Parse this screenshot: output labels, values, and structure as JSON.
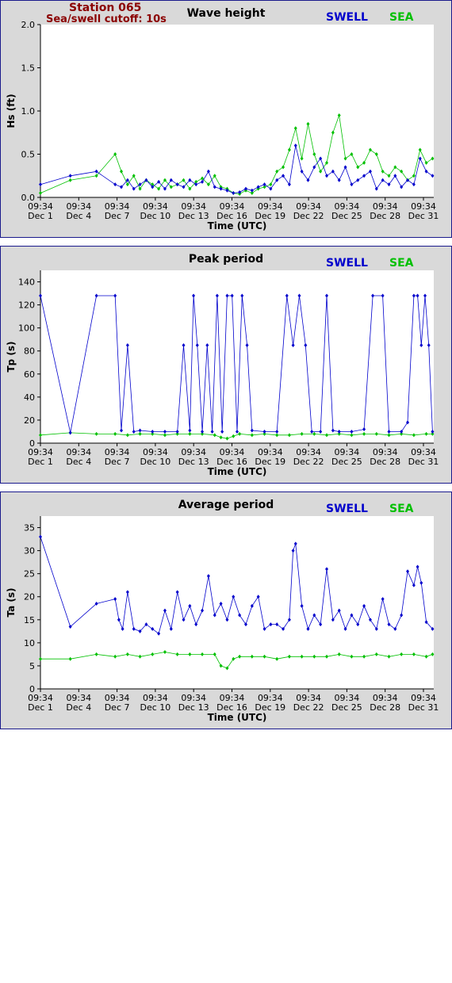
{
  "header": {
    "station": "Station 065",
    "cutoff": "Sea/swell cutoff: 10s"
  },
  "legend": {
    "swell": "SWELL",
    "sea": "SEA"
  },
  "colors": {
    "swell": "#0000cc",
    "sea": "#00c000",
    "frame": "#1a1a8c",
    "header": "#8b0000"
  },
  "x_axis": {
    "label": "Time (UTC)",
    "ticks": [
      {
        "time": "09:34",
        "date": "Dec 1"
      },
      {
        "time": "09:34",
        "date": "Dec 4"
      },
      {
        "time": "09:34",
        "date": "Dec 7"
      },
      {
        "time": "09:34",
        "date": "Dec 10"
      },
      {
        "time": "09:34",
        "date": "Dec 13"
      },
      {
        "time": "09:34",
        "date": "Dec 16"
      },
      {
        "time": "09:34",
        "date": "Dec 19"
      },
      {
        "time": "09:34",
        "date": "Dec 22"
      },
      {
        "time": "09:34",
        "date": "Dec 25"
      },
      {
        "time": "09:34",
        "date": "Dec 28"
      },
      {
        "time": "09:34",
        "date": "Dec 31"
      }
    ]
  },
  "chart_data": [
    {
      "type": "scatter",
      "title": "Wave height",
      "ylabel": "Hs (ft)",
      "xlabel": "Time (UTC)",
      "x_unit": "day of December",
      "xlim": [
        1,
        32.6
      ],
      "ylim": [
        0,
        2.0
      ],
      "yticks": [
        "0.0",
        "0.5",
        "1.0",
        "1.5",
        "2.0"
      ],
      "ytick_values": [
        0,
        0.5,
        1.0,
        1.5,
        2.0
      ],
      "series": [
        {
          "name": "SWELL",
          "x": [
            1.0,
            3.4,
            5.5,
            7.0,
            7.5,
            8.0,
            8.5,
            9.0,
            9.5,
            10.0,
            10.5,
            11.0,
            11.5,
            12.0,
            12.5,
            13.0,
            13.5,
            14.0,
            14.5,
            15.0,
            15.5,
            16.0,
            16.5,
            17.0,
            17.5,
            18.0,
            18.5,
            19.0,
            19.5,
            20.0,
            20.5,
            21.0,
            21.5,
            22.0,
            22.5,
            23.0,
            23.5,
            24.0,
            24.5,
            25.0,
            25.5,
            26.0,
            26.5,
            27.0,
            27.5,
            28.0,
            28.5,
            29.0,
            29.5,
            30.0,
            30.5,
            31.0,
            31.5,
            32.0,
            32.5
          ],
          "y": [
            0.15,
            0.25,
            0.3,
            0.15,
            0.12,
            0.2,
            0.1,
            0.15,
            0.2,
            0.12,
            0.18,
            0.1,
            0.2,
            0.15,
            0.12,
            0.2,
            0.15,
            0.18,
            0.3,
            0.12,
            0.1,
            0.08,
            0.05,
            0.06,
            0.1,
            0.08,
            0.12,
            0.15,
            0.1,
            0.2,
            0.25,
            0.15,
            0.6,
            0.3,
            0.2,
            0.35,
            0.45,
            0.25,
            0.3,
            0.2,
            0.35,
            0.15,
            0.2,
            0.25,
            0.3,
            0.1,
            0.2,
            0.15,
            0.25,
            0.12,
            0.2,
            0.15,
            0.45,
            0.3,
            0.25
          ]
        },
        {
          "name": "SEA",
          "x": [
            1.0,
            3.4,
            5.5,
            7.0,
            7.5,
            8.0,
            8.5,
            9.0,
            9.5,
            10.0,
            10.5,
            11.0,
            11.5,
            12.0,
            12.5,
            13.0,
            13.5,
            14.0,
            14.5,
            15.0,
            15.5,
            16.0,
            16.5,
            17.0,
            17.5,
            18.0,
            18.5,
            19.0,
            19.5,
            20.0,
            20.5,
            21.0,
            21.5,
            22.0,
            22.5,
            23.0,
            23.5,
            24.0,
            24.5,
            25.0,
            25.5,
            26.0,
            26.5,
            27.0,
            27.5,
            28.0,
            28.5,
            29.0,
            29.5,
            30.0,
            30.5,
            31.0,
            31.5,
            32.0,
            32.5
          ],
          "y": [
            0.05,
            0.2,
            0.25,
            0.5,
            0.3,
            0.15,
            0.25,
            0.1,
            0.2,
            0.15,
            0.1,
            0.2,
            0.12,
            0.15,
            0.2,
            0.1,
            0.18,
            0.22,
            0.15,
            0.25,
            0.12,
            0.1,
            0.05,
            0.04,
            0.08,
            0.05,
            0.1,
            0.12,
            0.15,
            0.3,
            0.35,
            0.55,
            0.8,
            0.45,
            0.85,
            0.5,
            0.3,
            0.4,
            0.75,
            0.95,
            0.45,
            0.5,
            0.35,
            0.4,
            0.55,
            0.5,
            0.3,
            0.25,
            0.35,
            0.3,
            0.2,
            0.25,
            0.55,
            0.4,
            0.45
          ]
        }
      ]
    },
    {
      "type": "scatter",
      "title": "Peak period",
      "ylabel": "Tp (s)",
      "xlabel": "Time (UTC)",
      "x_unit": "day of December",
      "xlim": [
        1,
        32.6
      ],
      "ylim": [
        0,
        150
      ],
      "yticks": [
        "0",
        "20",
        "40",
        "60",
        "80",
        "100",
        "120",
        "140"
      ],
      "ytick_values": [
        0,
        20,
        40,
        60,
        80,
        100,
        120,
        140
      ],
      "series": [
        {
          "name": "SWELL",
          "x": [
            1.0,
            3.4,
            5.5,
            7.0,
            7.5,
            8.0,
            8.5,
            9.0,
            10.0,
            11.0,
            12.0,
            12.5,
            13.0,
            13.3,
            13.6,
            14.0,
            14.4,
            14.8,
            15.2,
            15.6,
            16.0,
            16.4,
            16.8,
            17.2,
            17.6,
            18.0,
            19.0,
            20.0,
            20.8,
            21.3,
            21.8,
            22.3,
            22.8,
            23.5,
            24.0,
            24.5,
            25.0,
            26.0,
            27.0,
            27.7,
            28.5,
            29.0,
            30.0,
            30.5,
            31.0,
            31.3,
            31.6,
            31.9,
            32.2,
            32.5
          ],
          "y": [
            128,
            9,
            128,
            128,
            11,
            85,
            10,
            11,
            10,
            10,
            10,
            85,
            11,
            128,
            85,
            10,
            85,
            10,
            128,
            10,
            128,
            128,
            10,
            128,
            85,
            11,
            10,
            10,
            128,
            85,
            128,
            85,
            10,
            10,
            128,
            11,
            10,
            10,
            12,
            128,
            128,
            10,
            10,
            18,
            128,
            128,
            85,
            128,
            85,
            10
          ]
        },
        {
          "name": "SEA",
          "x": [
            1.0,
            3.4,
            5.5,
            7.0,
            8.0,
            9.0,
            10.0,
            11.0,
            12.0,
            13.0,
            14.0,
            15.0,
            15.5,
            16.0,
            16.5,
            17.0,
            18.0,
            19.0,
            20.0,
            21.0,
            22.0,
            23.0,
            24.0,
            25.0,
            26.0,
            27.0,
            28.0,
            29.0,
            30.0,
            31.0,
            32.0,
            32.5
          ],
          "y": [
            7,
            9,
            8,
            8,
            7,
            8,
            8,
            7,
            8,
            8,
            8,
            7,
            5,
            4,
            6,
            8,
            7,
            8,
            7,
            7,
            8,
            8,
            7,
            8,
            7,
            8,
            8,
            7,
            8,
            7,
            8,
            8
          ]
        }
      ]
    },
    {
      "type": "scatter",
      "title": "Average period",
      "ylabel": "Ta (s)",
      "xlabel": "Time (UTC)",
      "x_unit": "day of December",
      "xlim": [
        1,
        32.6
      ],
      "ylim": [
        0,
        37.5
      ],
      "yticks": [
        "0",
        "5",
        "10",
        "15",
        "20",
        "25",
        "30",
        "35"
      ],
      "ytick_values": [
        0,
        5,
        10,
        15,
        20,
        25,
        30,
        35
      ],
      "series": [
        {
          "name": "SWELL",
          "x": [
            1.0,
            3.4,
            5.5,
            7.0,
            7.3,
            7.6,
            8.0,
            8.5,
            9.0,
            9.5,
            10.0,
            10.5,
            11.0,
            11.5,
            12.0,
            12.5,
            13.0,
            13.5,
            14.0,
            14.5,
            15.0,
            15.5,
            16.0,
            16.5,
            17.0,
            17.5,
            18.0,
            18.5,
            19.0,
            19.5,
            20.0,
            20.5,
            21.0,
            21.3,
            21.5,
            22.0,
            22.5,
            23.0,
            23.5,
            24.0,
            24.5,
            25.0,
            25.5,
            26.0,
            26.5,
            27.0,
            27.5,
            28.0,
            28.5,
            29.0,
            29.5,
            30.0,
            30.5,
            31.0,
            31.3,
            31.6,
            32.0,
            32.5
          ],
          "y": [
            33,
            13.5,
            18.5,
            19.5,
            15,
            13,
            21,
            13,
            12.5,
            14,
            13,
            12,
            17,
            13,
            21,
            15,
            18,
            14,
            17,
            24.5,
            16,
            18.5,
            15,
            20,
            16,
            14,
            18,
            20,
            13,
            14,
            14,
            13,
            15,
            30,
            31.5,
            18,
            13,
            16,
            14,
            26,
            15,
            17,
            13,
            16,
            14,
            18,
            15,
            13,
            19.5,
            14,
            13,
            16,
            25.5,
            22.5,
            26.5,
            23,
            14.5,
            13
          ]
        },
        {
          "name": "SEA",
          "x": [
            1.0,
            3.4,
            5.5,
            7.0,
            8.0,
            9.0,
            10.0,
            11.0,
            12.0,
            13.0,
            14.0,
            15.0,
            15.5,
            16.0,
            16.5,
            17.0,
            18.0,
            19.0,
            20.0,
            21.0,
            22.0,
            23.0,
            24.0,
            25.0,
            26.0,
            27.0,
            28.0,
            29.0,
            30.0,
            31.0,
            32.0,
            32.5
          ],
          "y": [
            6.5,
            6.5,
            7.5,
            7,
            7.5,
            7,
            7.5,
            8,
            7.5,
            7.5,
            7.5,
            7.5,
            5,
            4.5,
            6.5,
            7,
            7,
            7,
            6.5,
            7,
            7,
            7,
            7,
            7.5,
            7,
            7,
            7.5,
            7,
            7.5,
            7.5,
            7,
            7.5
          ]
        }
      ]
    }
  ]
}
